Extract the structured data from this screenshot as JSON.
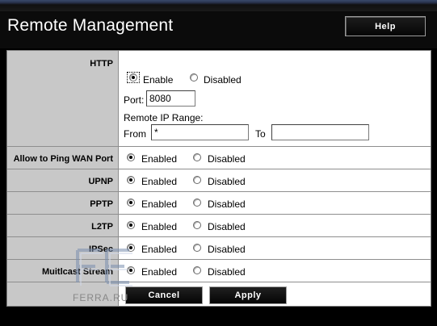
{
  "header": {
    "title": "Remote Management",
    "help_label": "Help"
  },
  "http": {
    "label": "HTTP",
    "enable_label": "Enable",
    "disabled_label": "Disabled",
    "port_label": "Port:",
    "port_value": "8080",
    "range_label": "Remote IP Range:",
    "from_label": "From",
    "from_value": "*",
    "to_label": "To",
    "to_value": ""
  },
  "rows": [
    {
      "label": "Allow to Ping WAN Port",
      "enabled": "Enabled",
      "disabled": "Disabled"
    },
    {
      "label": "UPNP",
      "enabled": "Enabled",
      "disabled": "Disabled"
    },
    {
      "label": "PPTP",
      "enabled": "Enabled",
      "disabled": "Disabled"
    },
    {
      "label": "L2TP",
      "enabled": "Enabled",
      "disabled": "Disabled"
    },
    {
      "label": "IPSec",
      "enabled": "Enabled",
      "disabled": "Disabled"
    },
    {
      "label": "Muitlcast Stream",
      "enabled": "Enabled",
      "disabled": "Disabled"
    }
  ],
  "buttons": {
    "cancel": "Cancel",
    "apply": "Apply"
  },
  "watermark": {
    "text": "FERRA.RU"
  }
}
